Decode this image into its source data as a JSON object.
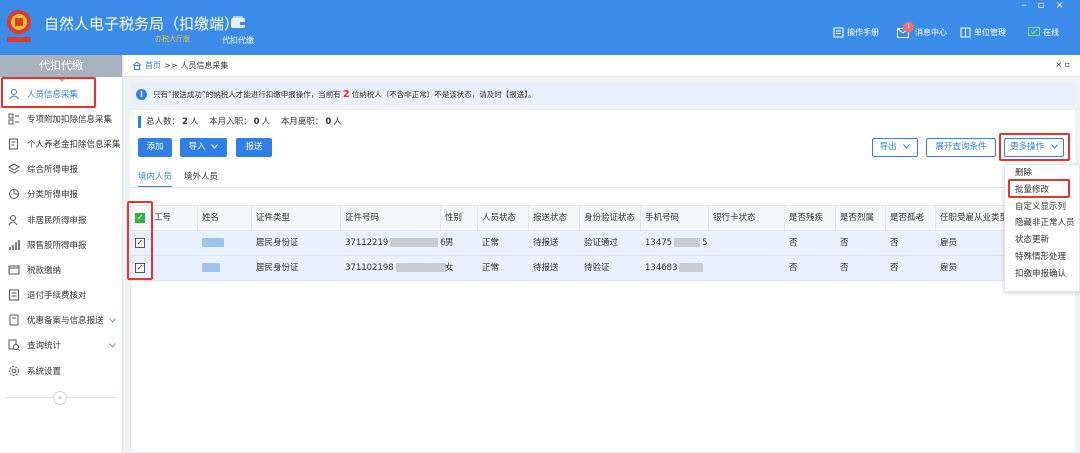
{
  "app": {
    "title": "自然人电子税务局（扣缴端）",
    "subtitle": "办税大厅版",
    "module_label": "代扣代缴",
    "window_controls": "– ▫ ×"
  },
  "header_tools": [
    {
      "label": "操作手册",
      "icon": "manual-icon"
    },
    {
      "label": "消息中心",
      "icon": "mail-icon",
      "badge": "1"
    },
    {
      "label": "单位管理",
      "icon": "building-icon"
    },
    {
      "label": "在线",
      "icon": "online-icon"
    }
  ],
  "sidebar": {
    "header": "代扣代缴",
    "items": [
      {
        "label": "人员信息采集",
        "icon": "person-icon",
        "active": true
      },
      {
        "label": "专项附加扣除信息采集",
        "icon": "list-icon"
      },
      {
        "label": "个人养老金扣除信息采集",
        "icon": "pension-icon"
      },
      {
        "label": "综合所得申报",
        "icon": "layers-icon"
      },
      {
        "label": "分类所得申报",
        "icon": "pie-icon"
      },
      {
        "label": "非居民所得申报",
        "icon": "user-outline-icon"
      },
      {
        "label": "限售股所得申报",
        "icon": "bar-chart-icon"
      },
      {
        "label": "税款缴纳",
        "icon": "wallet-icon"
      },
      {
        "label": "退付手续费核对",
        "icon": "receipt-icon"
      },
      {
        "label": "优惠备案与信息报送",
        "icon": "doc-icon",
        "expandable": true
      },
      {
        "label": "查询统计",
        "icon": "query-icon",
        "expandable": true
      },
      {
        "label": "系统设置",
        "icon": "gear-icon"
      }
    ],
    "collapse_symbol": "«"
  },
  "breadcrumb": {
    "home": "首页",
    "separator": ">>",
    "current": "人员信息采集",
    "close": "× ▫"
  },
  "notice": {
    "before": "只有“报送成功”的纳税人才能进行扣缴申报操作，当前有",
    "count": "2",
    "after": "位纳税人（不含非正常）不是该状态，请及时【报送】。"
  },
  "stats": {
    "total_label": "总人数：",
    "total": "2",
    "unit": "人",
    "joined_label": "本月入职：",
    "joined": "0",
    "left_label": "本月离职：",
    "left": "0"
  },
  "toolbar": {
    "add": "添加",
    "import": "导入",
    "submit": "报送",
    "export": "导出",
    "expand_query": "展开查询条件",
    "more": "更多操作"
  },
  "tabs": [
    "境内人员",
    "境外人员"
  ],
  "table": {
    "columns": [
      "工号",
      "姓名",
      "证件类型",
      "证件号码",
      "性别",
      "人员状态",
      "报送状态",
      "身份验证状态",
      "手机号码",
      "银行卡状态",
      "是否残疾",
      "是否烈属",
      "是否孤老",
      "任职受雇从业类型"
    ],
    "rows": [
      {
        "checked": true,
        "id_type": "居民身份证",
        "id_no_start": "37112219",
        "id_no_end": "6",
        "gender": "男",
        "status": "正常",
        "report": "待报送",
        "verify": "验证通过",
        "phone_start": "13475",
        "phone_end": "5",
        "bank": "",
        "disabled": "否",
        "martyr": "否",
        "elderly": "否",
        "employ": "雇员"
      },
      {
        "checked": true,
        "id_type": "居民身份证",
        "id_no_start": "371102198",
        "id_no_end": "",
        "gender": "女",
        "status": "正常",
        "report": "待报送",
        "verify": "待验证",
        "phone_start": "134683",
        "phone_end": "",
        "bank": "",
        "disabled": "否",
        "martyr": "否",
        "elderly": "否",
        "employ": "雇员"
      }
    ]
  },
  "more_menu": [
    "删除",
    "批量修改",
    "自定义显示列",
    "隐藏非正常人员",
    "状态更新",
    "特殊情形处理",
    "扣缴申报确认"
  ],
  "colors": {
    "primary": "#2f7fe6",
    "header": "#3b8be8",
    "highlight": "#e8322e",
    "checkbox": "#2fb53f"
  }
}
